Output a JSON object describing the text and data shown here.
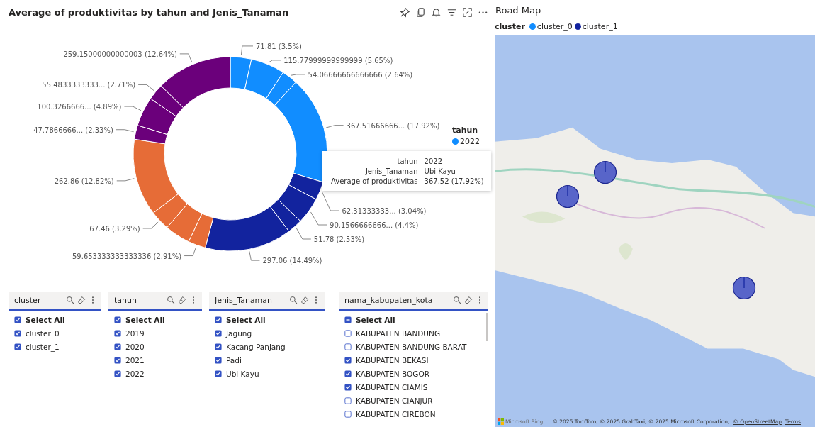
{
  "donut_visual": {
    "chart_data": {
      "type": "donut",
      "title": "Average of produktivitas by tahun and Jenis_Tanaman",
      "values": [
        71.81,
        115.77999999999999,
        54.06666666666666,
        367.51666666,
        62.31333333,
        90.1566666666,
        51.78,
        297.06,
        59.653333333333336,
        86.97,
        67.46,
        262.86,
        47.7866666,
        100.3266666,
        55.4833333333,
        259.15000000000003
      ],
      "colors": [
        "#118dff",
        "#118dff",
        "#118dff",
        "#118dff",
        "#12239e",
        "#12239e",
        "#12239e",
        "#12239e",
        "#e66c37",
        "#e66c37",
        "#e66c37",
        "#e66c37",
        "#6b007b",
        "#6b007b",
        "#6b007b",
        "#6b007b"
      ],
      "value_labels": [
        "71.81 (3.5%)",
        "115.77999999999999 (5.65%)",
        "54.06666666666666 (2.64%)",
        "367.51666666... (17.92%)",
        "62.31333333... (3.04%)",
        "90.1566666666... (4.4%)",
        "51.78 (2.53%)",
        "297.06 (14.49%)",
        "59.653333333333336 (2.91%)",
        null,
        "67.46 (3.29%)",
        "262.86 (12.82%)",
        "47.7866666... (2.33%)",
        "100.3266666... (4.89%)",
        "55.4833333333... (2.71%)",
        "259.15000000000003 (12.64%)"
      ]
    },
    "legend": {
      "title": "tahun",
      "items": [
        {
          "label": "2022",
          "color": "#118dff"
        }
      ]
    },
    "tooltip": [
      {
        "label": "tahun",
        "value": "2022"
      },
      {
        "label": "Jenis_Tanaman",
        "value": "Ubi Kayu"
      },
      {
        "label": "Average of produktivitas",
        "value": "367.52 (17.92%)"
      }
    ]
  },
  "slicers": [
    {
      "title": "cluster",
      "items": [
        {
          "label": "Select All",
          "kind": "select_all",
          "checked": true,
          "indeterminate": false
        },
        {
          "label": "cluster_0",
          "kind": "option",
          "checked": true,
          "indeterminate": false
        },
        {
          "label": "cluster_1",
          "kind": "option",
          "checked": true,
          "indeterminate": false
        }
      ]
    },
    {
      "title": "tahun",
      "items": [
        {
          "label": "Select All",
          "kind": "select_all",
          "checked": true,
          "indeterminate": false
        },
        {
          "label": "2019",
          "kind": "option",
          "checked": true,
          "indeterminate": false
        },
        {
          "label": "2020",
          "kind": "option",
          "checked": true,
          "indeterminate": false
        },
        {
          "label": "2021",
          "kind": "option",
          "checked": true,
          "indeterminate": false
        },
        {
          "label": "2022",
          "kind": "option",
          "checked": true,
          "indeterminate": false
        }
      ]
    },
    {
      "title": "Jenis_Tanaman",
      "items": [
        {
          "label": "Select All",
          "kind": "select_all",
          "checked": true,
          "indeterminate": false
        },
        {
          "label": "Jagung",
          "kind": "option",
          "checked": true,
          "indeterminate": false
        },
        {
          "label": "Kacang Panjang",
          "kind": "option",
          "checked": true,
          "indeterminate": false
        },
        {
          "label": "Padi",
          "kind": "option",
          "checked": true,
          "indeterminate": false
        },
        {
          "label": "Ubi Kayu",
          "kind": "option",
          "checked": true,
          "indeterminate": false
        }
      ]
    },
    {
      "title": "nama_kabupaten_kota",
      "scrollbar": true,
      "items": [
        {
          "label": "Select All",
          "kind": "select_all",
          "checked": false,
          "indeterminate": true
        },
        {
          "label": "KABUPATEN BANDUNG",
          "kind": "option",
          "checked": false,
          "indeterminate": false
        },
        {
          "label": "KABUPATEN BANDUNG BARAT",
          "kind": "option",
          "checked": false,
          "indeterminate": false
        },
        {
          "label": "KABUPATEN BEKASI",
          "kind": "option",
          "checked": true,
          "indeterminate": false
        },
        {
          "label": "KABUPATEN BOGOR",
          "kind": "option",
          "checked": true,
          "indeterminate": false
        },
        {
          "label": "KABUPATEN CIAMIS",
          "kind": "option",
          "checked": true,
          "indeterminate": false
        },
        {
          "label": "KABUPATEN CIANJUR",
          "kind": "option",
          "checked": false,
          "indeterminate": false
        },
        {
          "label": "KABUPATEN CIREBON",
          "kind": "option",
          "checked": false,
          "indeterminate": false
        }
      ]
    }
  ],
  "map_visual": {
    "title": "Road Map",
    "legend": {
      "title": "cluster",
      "items": [
        {
          "label": "cluster_0",
          "color": "#118dff"
        },
        {
          "label": "cluster_1",
          "color": "#12239e"
        }
      ]
    },
    "map": {
      "kind": "picture"
    },
    "bing_logo": "Microsoft Bing",
    "attribution": "© 2025 TomTom, © 2025 GrabTaxi, © 2025 Microsoft Corporation,",
    "attribution_links": [
      "© OpenStreetMap",
      "Terms"
    ]
  }
}
